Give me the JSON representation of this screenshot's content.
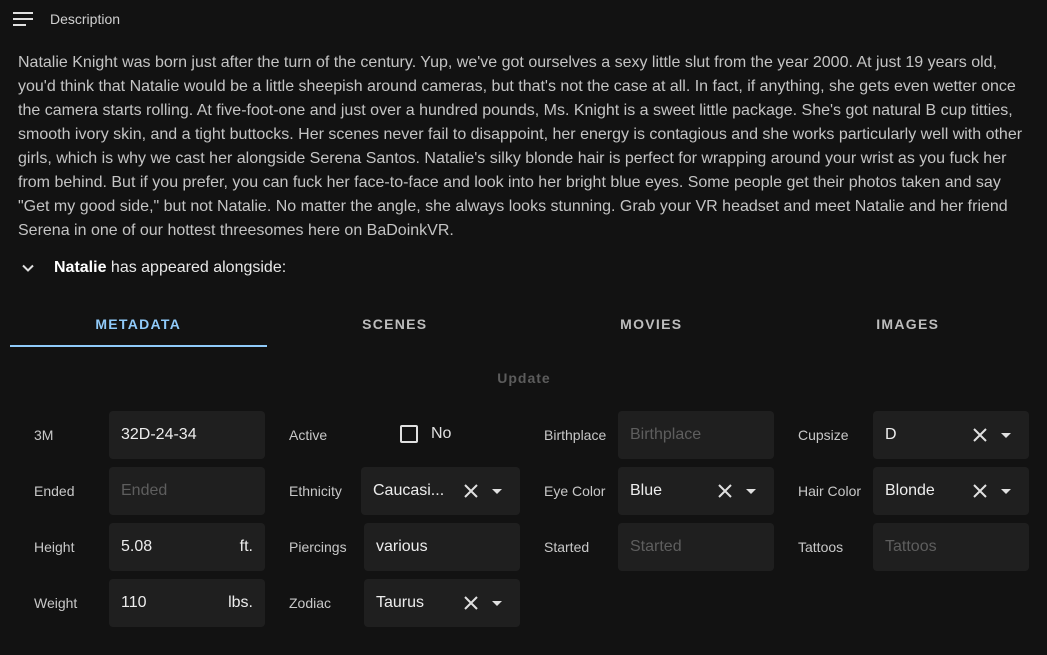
{
  "header": {
    "title": "Description",
    "menu_icon": "menu-icon"
  },
  "description": "Natalie Knight was born just after the turn of the century. Yup, we've got ourselves a sexy little slut from the year 2000. At just 19 years old, you'd think that Natalie would be a little sheepish around cameras, but that's not the case at all. In fact, if anything, she gets even wetter once the camera starts rolling. At five-foot-one and just over a hundred pounds, Ms. Knight is a sweet little package. She's got natural B cup titties, smooth ivory skin, and a tight buttocks. Her scenes never fail to disappoint, her energy is contagious and she works particularly well with other girls, which is why we cast her alongside Serena Santos. Natalie's silky blonde hair is perfect for wrapping around your wrist as you fuck her from behind. But if you prefer, you can fuck her face-to-face and look into her bright blue eyes. Some people get their photos taken and say \"Get my good side,\" but not Natalie. No matter the angle, she always looks stunning. Grab your VR headset and meet Natalie and her friend Serena in one of our hottest threesomes here on BaDoinkVR.",
  "alongside": {
    "name": "Natalie",
    "suffix": " has appeared alongside:",
    "icon": "chevron-down-icon"
  },
  "tabs": [
    {
      "label": "METADATA",
      "active": true
    },
    {
      "label": "SCENES",
      "active": false
    },
    {
      "label": "MOVIES",
      "active": false
    },
    {
      "label": "IMAGES",
      "active": false
    }
  ],
  "update_label": "Update",
  "accent_color": "#90caf9",
  "fields": {
    "measurements": {
      "label": "3M",
      "value": "32D-24-34"
    },
    "active": {
      "label": "Active",
      "checkbox_label": "No",
      "checked": false
    },
    "birthplace": {
      "label": "Birthplace",
      "placeholder": "Birthplace"
    },
    "cupsize": {
      "label": "Cupsize",
      "value": "D"
    },
    "ended": {
      "label": "Ended",
      "placeholder": "Ended"
    },
    "ethnicity": {
      "label": "Ethnicity",
      "value": "Caucasi..."
    },
    "eye_color": {
      "label": "Eye Color",
      "value": "Blue"
    },
    "hair_color": {
      "label": "Hair Color",
      "value": "Blonde"
    },
    "height": {
      "label": "Height",
      "value": "5.08",
      "unit": "ft."
    },
    "piercings": {
      "label": "Piercings",
      "value": "various"
    },
    "started": {
      "label": "Started",
      "placeholder": "Started"
    },
    "tattoos": {
      "label": "Tattoos",
      "placeholder": "Tattoos"
    },
    "weight": {
      "label": "Weight",
      "value": "110",
      "unit": "lbs."
    },
    "zodiac": {
      "label": "Zodiac",
      "value": "Taurus"
    }
  }
}
